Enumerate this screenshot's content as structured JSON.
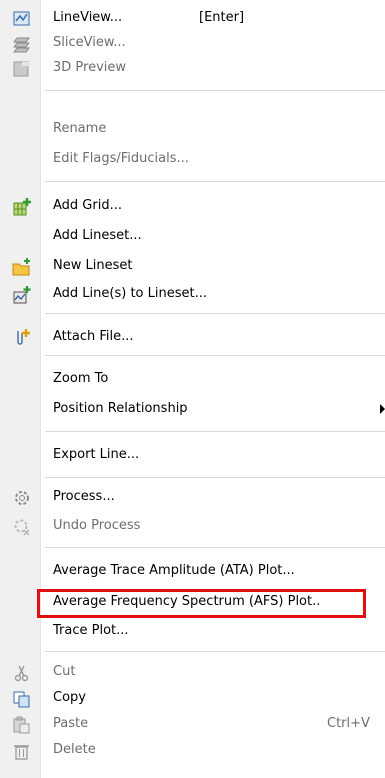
{
  "menu": {
    "items": [
      {
        "label": "LineView...",
        "shortcut": "[Enter]",
        "icon": "lineview-icon",
        "disabled": false
      },
      {
        "label": "SliceView...",
        "icon": "sliceview-icon",
        "disabled": true
      },
      {
        "label": "3D Preview",
        "icon": "3d-preview-icon",
        "disabled": true
      },
      {
        "label": "Rename",
        "disabled": true
      },
      {
        "label": "Edit Flags/Fiducials...",
        "disabled": true
      },
      {
        "label": "Add Grid...",
        "icon": "add-grid-icon",
        "disabled": false
      },
      {
        "label": "Add Lineset...",
        "disabled": false
      },
      {
        "label": "New Lineset",
        "icon": "new-lineset-folder-icon",
        "disabled": false
      },
      {
        "label": "Add Line(s) to Lineset...",
        "icon": "add-lines-icon",
        "disabled": false
      },
      {
        "label": "Attach File...",
        "icon": "attach-file-icon",
        "disabled": false
      },
      {
        "label": "Zoom To",
        "disabled": false
      },
      {
        "label": "Position Relationship",
        "disabled": false,
        "submenu": true
      },
      {
        "label": "Export Line...",
        "disabled": false
      },
      {
        "label": "Process...",
        "icon": "process-gear-icon",
        "disabled": false
      },
      {
        "label": "Undo Process",
        "icon": "undo-process-icon",
        "disabled": true
      },
      {
        "label": "Average Trace Amplitude (ATA) Plot...",
        "disabled": false
      },
      {
        "label": "Average Frequency Spectrum (AFS) Plot..",
        "disabled": false,
        "highlighted": true
      },
      {
        "label": "Trace Plot...",
        "disabled": false
      },
      {
        "label": "Cut",
        "icon": "scissors-icon",
        "disabled": true
      },
      {
        "label": "Copy",
        "icon": "copy-icon",
        "disabled": false
      },
      {
        "label": "Paste",
        "shortcut": "Ctrl+V",
        "icon": "paste-icon",
        "disabled": true
      },
      {
        "label": "Delete",
        "icon": "trash-icon",
        "disabled": true
      }
    ]
  },
  "colors": {
    "highlight_border": "#e01010",
    "disabled_text": "#6d6d6d",
    "gutter": "#f0f0f0"
  }
}
